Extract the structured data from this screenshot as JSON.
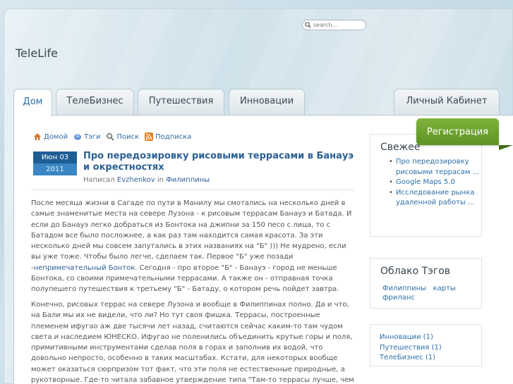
{
  "site": {
    "title": "TeleLife"
  },
  "search": {
    "placeholder": "search..."
  },
  "tabs": [
    {
      "label": "Дом",
      "active": true
    },
    {
      "label": "ТелеБизнес"
    },
    {
      "label": "Путешествия"
    },
    {
      "label": "Инновации"
    },
    {
      "label": "Личный Кабинет"
    }
  ],
  "register": {
    "label": "Регистрация"
  },
  "crumbs": {
    "home": "Домой",
    "tags": "Тэги",
    "search": "Поиск",
    "subscribe": "Подписка"
  },
  "post": {
    "date_day": "Июн 03",
    "date_year": "2011",
    "title": "Про передозировку рисовыми террасами в Банауэ и окрестностях",
    "by_prefix": "Написал",
    "author": "Evzhenkov",
    "in_word": "in",
    "category": "Филиппины",
    "p1_a": "После месяца жизни в Сагаде по пути в Манилу мы смотались на несколько дней в самые знаменитые места на севере Лузона - к рисовым террасам Банауэ и Батада. И если до Банауэ легко добраться из Бонтока на джипни за 150 песо с лица, то с Батадом все было посложнее, а как раз там находится самая красота. За эти несколько дней мы совсем запутались в этих названиях на \"Б\" ))) Не мудрено, если вы уже тоже. Чтобы было легче, сделаем так. Первое \"Б\" уже позади -",
    "p1_link": "непримечательный Бонток",
    "p1_b": ". Сегодня - про второе \"Б\" - Банауэ - город не меньше Бонтока, со своими примечательными террасами. А также он - отправная точка полупешего путешествия к третьему \"Б\" - Батаду, о котором речь пойдет завтра.",
    "p2": "Конечно, рисовых террас на севере Лузона и вообще в Филиппинах полно. Да и что, на Бали мы их не видели, что ли? Но тут своя фишка. Террасы, построенные племенем ифугао аж две тысячи лет назад, считаются сейчас каким-то там чудом света и наследием ЮНЕСКО. Ифугао не поленились объединить крутые горы и поля, примитивными инструментами сделав поля в горах и заполнив их водой, что довольно непросто, особенно в таких масштабах. Кстати, для некоторых вообще может оказаться сюрпризом тот факт, что эти поля не естественные природные, а рукотворные. Где-то читала забавное утверждение типа \"Там-то террасы лучше, чем"
  },
  "sidebar": {
    "fresh_title": "Свежее",
    "fresh_items": [
      "Про передозировку рисовыми террасам ...",
      "Google Maps 5.0",
      "Исследование рынка удаленной работы ..."
    ],
    "tags_title": "Облако Тэгов",
    "tags": [
      "Филиппины",
      "карты",
      "фриланс"
    ],
    "categories": [
      "Инновации (1)",
      "Путешествия (1)",
      "ТелеБизнес (1)"
    ]
  },
  "colors": {
    "accent": "#2d6fa8",
    "register": "#6fa52f",
    "date": "#1e5d95"
  }
}
